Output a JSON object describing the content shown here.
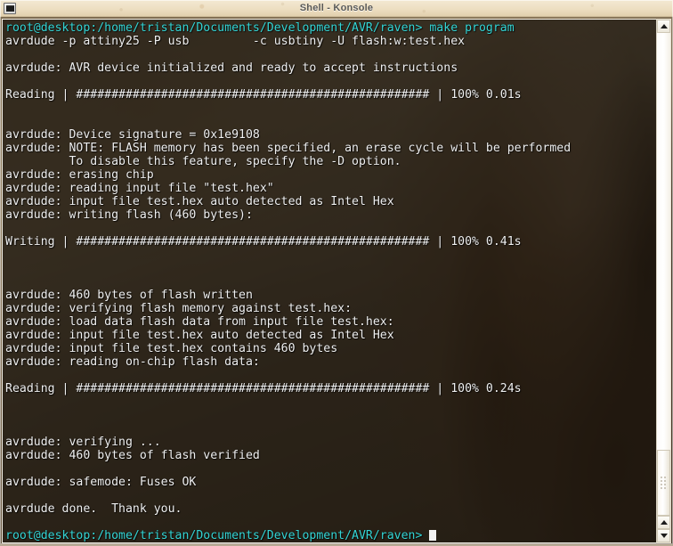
{
  "window": {
    "title": "Shell - Konsole",
    "icon": "terminal-icon"
  },
  "terminal": {
    "prompt_color": "#35d6d6",
    "text_color": "#f0f0f0",
    "background_color": "#120e09",
    "lines": [
      {
        "type": "prompt",
        "text": "root@desktop:/home/tristan/Documents/Development/AVR/raven> make program"
      },
      {
        "type": "output",
        "text": "avrdude -p attiny25 -P usb         -c usbtiny -U flash:w:test.hex"
      },
      {
        "type": "blank",
        "text": ""
      },
      {
        "type": "output",
        "text": "avrdude: AVR device initialized and ready to accept instructions"
      },
      {
        "type": "blank",
        "text": ""
      },
      {
        "type": "output",
        "text": "Reading | ################################################## | 100% 0.01s"
      },
      {
        "type": "blank",
        "text": ""
      },
      {
        "type": "blank",
        "text": ""
      },
      {
        "type": "output",
        "text": "avrdude: Device signature = 0x1e9108"
      },
      {
        "type": "output",
        "text": "avrdude: NOTE: FLASH memory has been specified, an erase cycle will be performed"
      },
      {
        "type": "output",
        "text": "         To disable this feature, specify the -D option."
      },
      {
        "type": "output",
        "text": "avrdude: erasing chip"
      },
      {
        "type": "output",
        "text": "avrdude: reading input file \"test.hex\""
      },
      {
        "type": "output",
        "text": "avrdude: input file test.hex auto detected as Intel Hex"
      },
      {
        "type": "output",
        "text": "avrdude: writing flash (460 bytes):"
      },
      {
        "type": "blank",
        "text": ""
      },
      {
        "type": "output",
        "text": "Writing | ################################################## | 100% 0.41s"
      },
      {
        "type": "blank",
        "text": ""
      },
      {
        "type": "blank",
        "text": ""
      },
      {
        "type": "blank",
        "text": ""
      },
      {
        "type": "output",
        "text": "avrdude: 460 bytes of flash written"
      },
      {
        "type": "output",
        "text": "avrdude: verifying flash memory against test.hex:"
      },
      {
        "type": "output",
        "text": "avrdude: load data flash data from input file test.hex:"
      },
      {
        "type": "output",
        "text": "avrdude: input file test.hex auto detected as Intel Hex"
      },
      {
        "type": "output",
        "text": "avrdude: input file test.hex contains 460 bytes"
      },
      {
        "type": "output",
        "text": "avrdude: reading on-chip flash data:"
      },
      {
        "type": "blank",
        "text": ""
      },
      {
        "type": "output",
        "text": "Reading | ################################################## | 100% 0.24s"
      },
      {
        "type": "blank",
        "text": ""
      },
      {
        "type": "blank",
        "text": ""
      },
      {
        "type": "blank",
        "text": ""
      },
      {
        "type": "output",
        "text": "avrdude: verifying ..."
      },
      {
        "type": "output",
        "text": "avrdude: 460 bytes of flash verified"
      },
      {
        "type": "blank",
        "text": ""
      },
      {
        "type": "output",
        "text": "avrdude: safemode: Fuses OK"
      },
      {
        "type": "blank",
        "text": ""
      },
      {
        "type": "output",
        "text": "avrdude done.  Thank you."
      },
      {
        "type": "blank",
        "text": ""
      },
      {
        "type": "cursor-prompt",
        "text": "root@desktop:/home/tristan/Documents/Development/AVR/raven> "
      }
    ]
  },
  "scrollbar": {
    "up_arrow": "▲",
    "down_arrow": "▼",
    "thumb_position": "bottom"
  }
}
